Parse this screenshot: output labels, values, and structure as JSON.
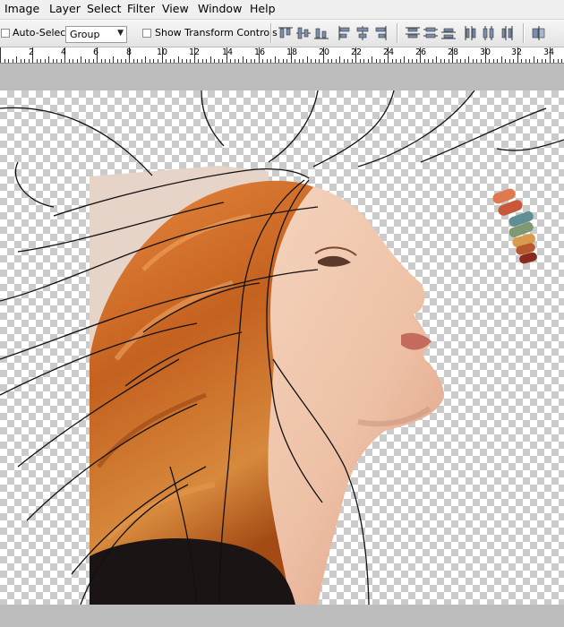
{
  "menu": {
    "items": [
      "Image",
      "Layer",
      "Select",
      "Filter",
      "View",
      "Window",
      "Help"
    ]
  },
  "options": {
    "auto_select_label": "Auto-Select:",
    "auto_select_value": "Group",
    "show_transform_label": "Show Transform Controls"
  },
  "ruler": {
    "labels": [
      "2",
      "4",
      "6",
      "8",
      "10",
      "12",
      "14",
      "16",
      "18",
      "20",
      "22",
      "24",
      "26",
      "28",
      "30",
      "32",
      "34"
    ]
  },
  "palette": {
    "swatches": [
      "#e07a4e",
      "#c9583a",
      "#5f8f94",
      "#7f9a72",
      "#d89b4e",
      "#b8562e",
      "#8a2a1e"
    ]
  }
}
